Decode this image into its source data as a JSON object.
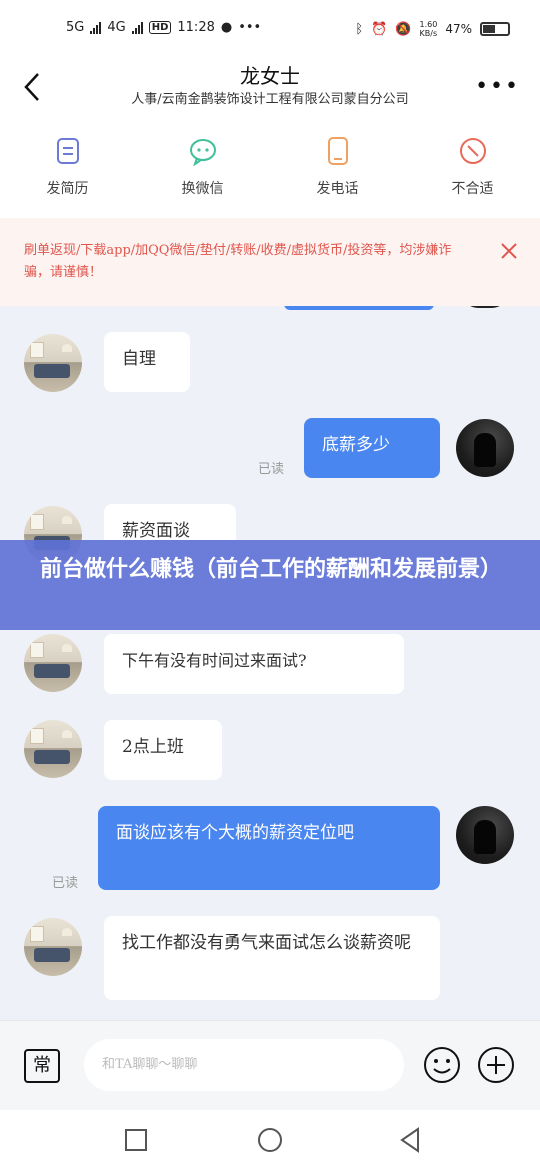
{
  "status": {
    "net1": "5G",
    "net2": "4G",
    "hd": "HD",
    "time": "11:28",
    "speed": "1.60\nKB/s",
    "battery": "47%"
  },
  "header": {
    "title": "龙女士",
    "subtitle": "人事/云南金鹊装饰设计工程有限公司蒙自分公司"
  },
  "actions": [
    {
      "label": "发简历",
      "icon": "resume-icon",
      "color": "#6b7bd6"
    },
    {
      "label": "换微信",
      "icon": "wechat-icon",
      "color": "#3fbf9a"
    },
    {
      "label": "发电话",
      "icon": "phone-icon",
      "color": "#f0a060"
    },
    {
      "label": "不合适",
      "icon": "not-suitable-icon",
      "color": "#e86a5a"
    }
  ],
  "warning": {
    "text": "刷单返现/下载app/加QQ微信/垫付/转账/收费/虚拟货币/投资等，均涉嫌诈骗，请谨慎！"
  },
  "messages": [
    {
      "side": "in",
      "text": "自理"
    },
    {
      "side": "out",
      "text": "底薪多少",
      "status": "已读"
    },
    {
      "side": "in",
      "text": "薪资面谈"
    },
    {
      "side": "in",
      "text": "下午有没有时间过来面试?"
    },
    {
      "side": "in",
      "text": "2点上班"
    },
    {
      "side": "out",
      "text": "面谈应该有个大概的薪资定位吧",
      "status": "已读"
    },
    {
      "side": "in",
      "text": "找工作都没有勇气来面试怎么谈薪资呢"
    }
  ],
  "banner": {
    "text": "前台做什么赚钱（前台工作的薪酬和发展前景）"
  },
  "input": {
    "mode_label": "常",
    "placeholder": "和TA聊聊～聊聊"
  },
  "colors": {
    "accent": "#4a86ef",
    "warning": "#e0564d",
    "banner": "#6072d6"
  }
}
